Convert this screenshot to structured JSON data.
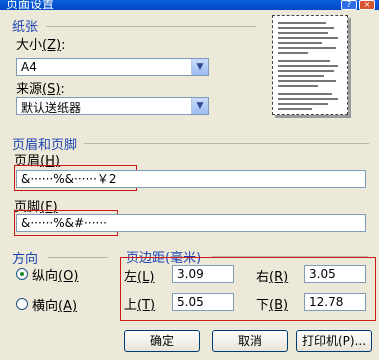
{
  "window": {
    "title": "页面设置",
    "help_glyph": "?",
    "close_glyph": "×"
  },
  "paper": {
    "group_label": "纸张",
    "size_label_pre": "大小",
    "size_label_key": "(Z)",
    "size_label_post": ":",
    "size_value": "A4",
    "source_label_pre": "来源",
    "source_label_key": "(S)",
    "source_label_post": ":",
    "source_value": "默认送纸器"
  },
  "header_footer": {
    "group_label": "页眉和页脚",
    "header_label_pre": "页眉",
    "header_label_key": "(H)",
    "header_value": "&······%&······￥2",
    "footer_label_pre": "页脚",
    "footer_label_key": "(F)",
    "footer_value": "&······%&#······"
  },
  "orientation": {
    "group_label": "方向",
    "portrait_label": "纵向",
    "portrait_key": "(O)",
    "landscape_label": "横向",
    "landscape_key": "(A)",
    "selected": "portrait"
  },
  "margins": {
    "group_label": "页边距(毫米)",
    "left_label": "左",
    "left_key": "(L)",
    "left_value": "3.09",
    "right_label": "右",
    "right_key": "(R)",
    "right_value": "3.05",
    "top_label": "上",
    "top_key": "(T)",
    "top_value": "5.05",
    "bottom_label": "下",
    "bottom_key": "(B)",
    "bottom_value": "12.78"
  },
  "buttons": {
    "ok": "确定",
    "cancel": "取消",
    "printer": "打印机(P)..."
  },
  "colors": {
    "group_label": "#1c44b3",
    "highlight_box": "#d01818"
  }
}
